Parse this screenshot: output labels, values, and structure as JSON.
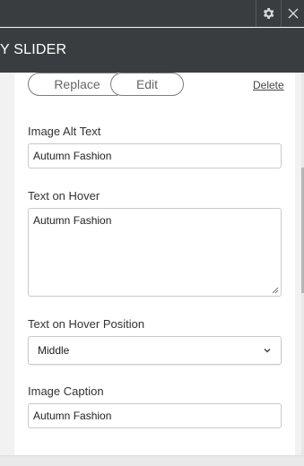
{
  "header": {
    "title": "Y SLIDER",
    "settings_icon": "gear-icon",
    "close_icon": "close-icon"
  },
  "image_actions": {
    "replace_label": "Replace",
    "edit_label": "Edit",
    "delete_label": "Delete"
  },
  "fields": {
    "alt_text": {
      "label": "Image Alt Text",
      "value": "Autumn Fashion"
    },
    "hover_text": {
      "label": "Text on Hover",
      "value": "Autumn Fashion"
    },
    "hover_position": {
      "label": "Text on Hover Position",
      "value": "Middle"
    },
    "caption": {
      "label": "Image Caption",
      "value": "Autumn Fashion"
    }
  },
  "colors": {
    "topbar": "#3a3d3f",
    "panel": "#ffffff",
    "background": "#f2f2f2"
  }
}
